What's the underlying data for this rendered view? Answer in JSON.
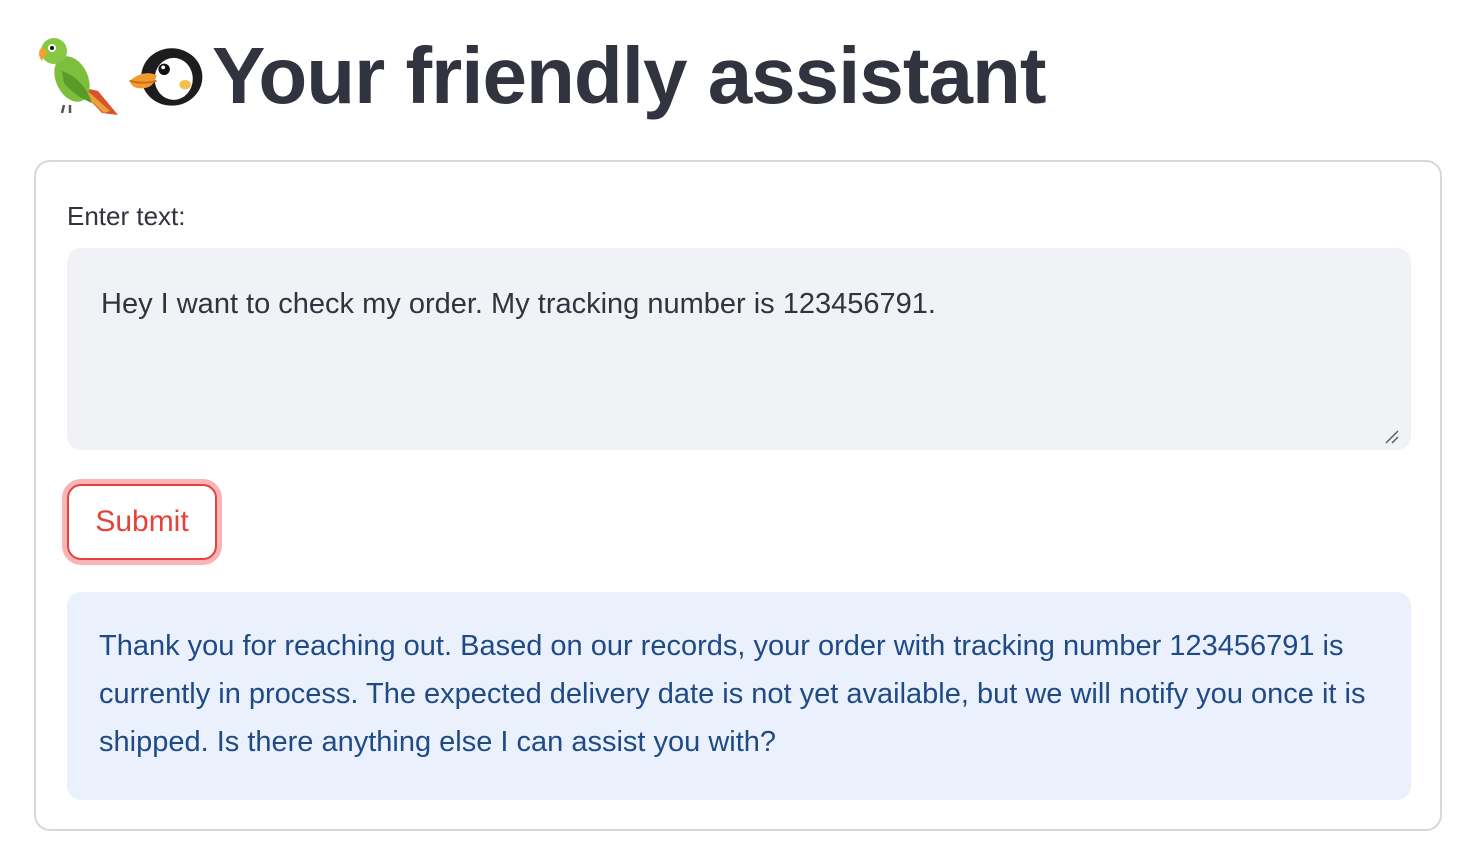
{
  "header": {
    "emoji_1": "parrot",
    "emoji_2": "penguin",
    "title": "Your friendly assistant"
  },
  "form": {
    "label": "Enter text:",
    "input_value": "Hey I want to check my order. My tracking number is 123456791.",
    "submit_label": "Submit"
  },
  "response": {
    "text": "Thank you for reaching out. Based on our records, your order with tracking number 123456791 is currently in process. The expected delivery date is not yet available, but we will notify you once it is shipped. Is there anything else I can assist you with?"
  },
  "colors": {
    "accent": "#e8413b",
    "info_bg": "#eaf1fc",
    "info_text": "#1f4a86",
    "input_bg": "#f0f2f6",
    "title_text": "#31333f"
  }
}
